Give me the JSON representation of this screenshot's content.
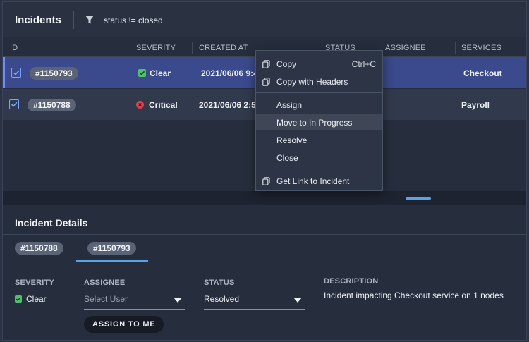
{
  "header": {
    "title": "Incidents",
    "filter": "status != closed"
  },
  "grid": {
    "columns": [
      "ID",
      "SEVERITY",
      "CREATED AT",
      "STATUS",
      "ASSIGNEE",
      "SERVICES"
    ],
    "rows": [
      {
        "id": "#1150793",
        "severity": "Clear",
        "created": "2021/06/06 9:4",
        "service": "Checkout"
      },
      {
        "id": "#1150788",
        "severity": "Critical",
        "created": "2021/06/06 2:5",
        "service": "Payroll"
      }
    ]
  },
  "context_menu": {
    "copy": "Copy",
    "copy_shortcut": "Ctrl+C",
    "copy_headers": "Copy with Headers",
    "assign": "Assign",
    "move_in_progress": "Move to In Progress",
    "resolve": "Resolve",
    "close": "Close",
    "get_link": "Get Link to Incident"
  },
  "details": {
    "title": "Incident Details",
    "tabs": [
      "#1150788",
      "#1150793"
    ],
    "severity_label": "SEVERITY",
    "severity_value": "Clear",
    "assignee_label": "ASSIGNEE",
    "assignee_placeholder": "Select User",
    "status_label": "STATUS",
    "status_value": "Resolved",
    "description_label": "DESCRIPTION",
    "description_value": "Incident impacting Checkout service on 1 nodes",
    "assign_button": "ASSIGN TO ME"
  },
  "colors": {
    "selected_row": "#3a4a8c",
    "accent": "#5aa1e8",
    "clear": "#4cc36a",
    "critical": "#e0414f"
  }
}
